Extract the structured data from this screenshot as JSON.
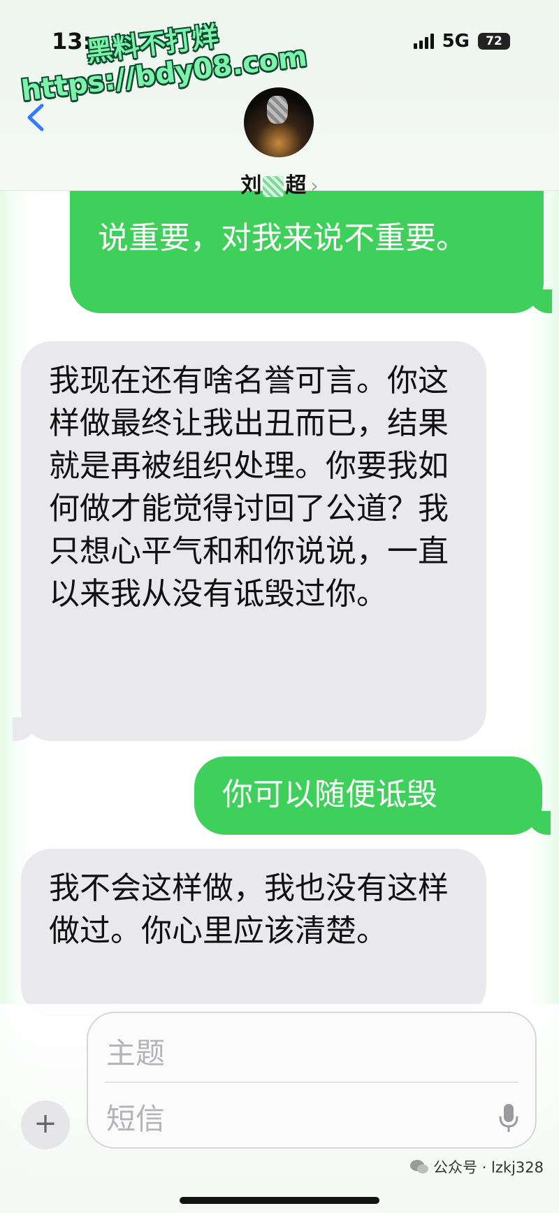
{
  "status": {
    "time": "13:",
    "network": "5G",
    "battery": "72"
  },
  "watermark": {
    "line1": "黑料不打烊",
    "line2": "https://bdy08.com"
  },
  "contact": {
    "name_start": "刘",
    "name_end": "超"
  },
  "messages": [
    {
      "direction": "outgoing",
      "text": "说重要，对我来说不重要。"
    },
    {
      "direction": "incoming",
      "text": "我现在还有啥名誉可言。你这样做最终让我出丑而已，结果就是再被组织处理。你要我如何做才能觉得讨回了公道？我只想心平气和和你说说，一直以来我从没有诋毁过你。"
    },
    {
      "direction": "outgoing",
      "text": "你可以随便诋毁"
    },
    {
      "direction": "incoming",
      "text": "我不会这样做，我也没有这样做过。你心里应该清楚。"
    }
  ],
  "compose": {
    "subject_placeholder": "主题",
    "message_placeholder": "短信",
    "plus_label": "+"
  },
  "credit": {
    "text": "公众号 · lzkj328"
  },
  "colors": {
    "outgoing": "#3fd05b",
    "incoming": "#e9e9ed",
    "link": "#2f7cf6",
    "watermark": "#7cf2ab"
  },
  "icons": [
    "back-chevron-icon",
    "mic-icon",
    "wechat-icon",
    "signal-icon",
    "battery-icon"
  ]
}
